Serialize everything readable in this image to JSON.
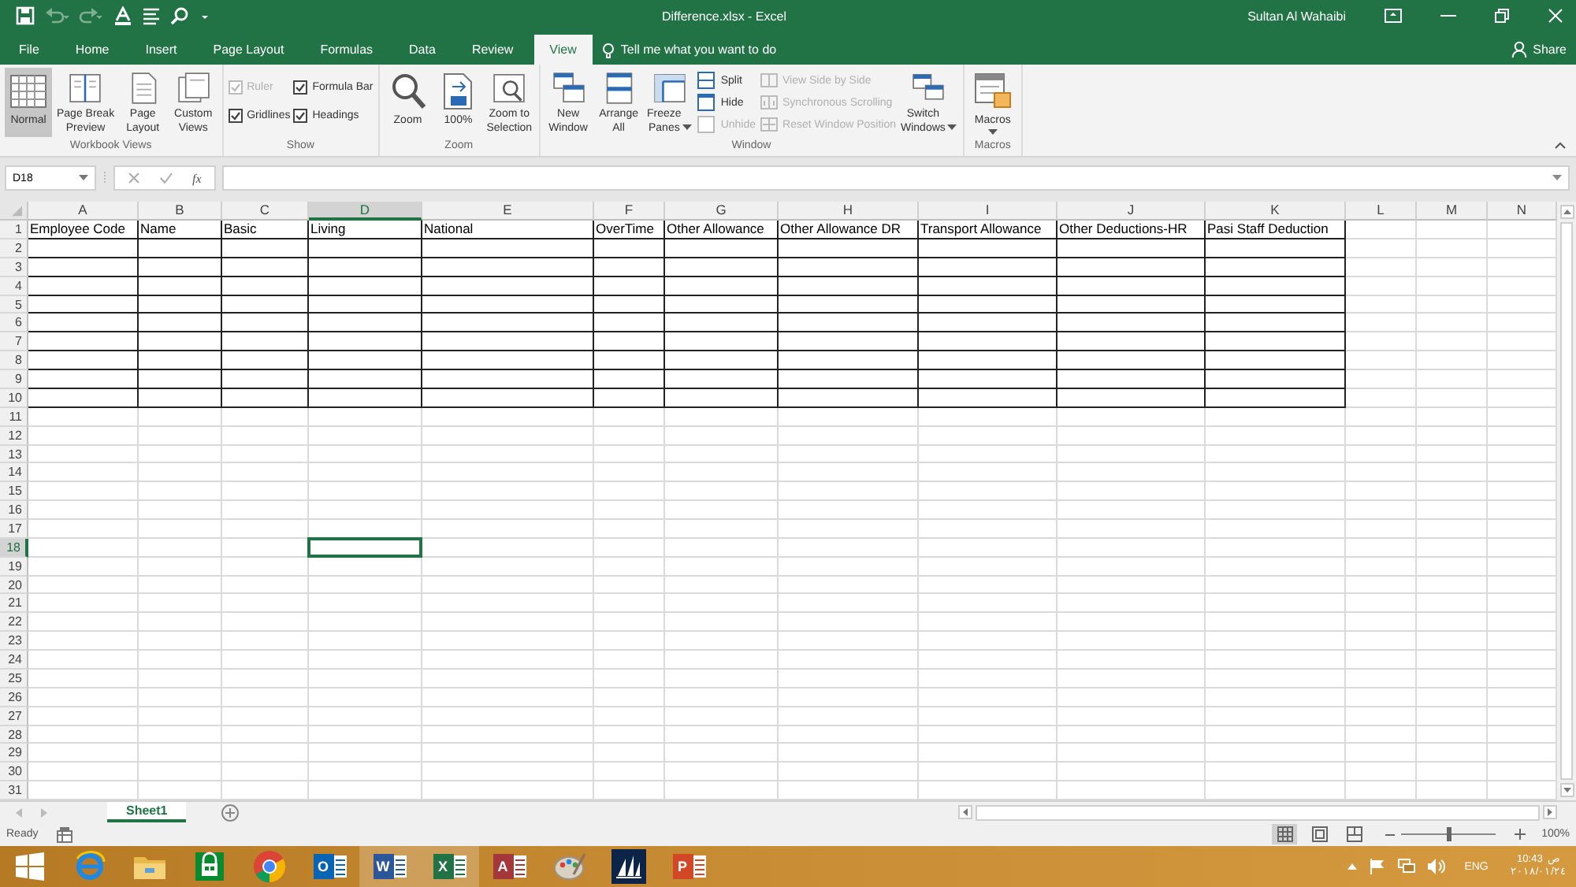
{
  "window": {
    "title": "Difference.xlsx  -  Excel",
    "user": "Sultan Al Wahaibi"
  },
  "tabs": [
    {
      "label": "File",
      "selected": false
    },
    {
      "label": "Home",
      "selected": false
    },
    {
      "label": "Insert",
      "selected": false
    },
    {
      "label": "Page Layout",
      "selected": false
    },
    {
      "label": "Formulas",
      "selected": false
    },
    {
      "label": "Data",
      "selected": false
    },
    {
      "label": "Review",
      "selected": false
    },
    {
      "label": "View",
      "selected": true
    }
  ],
  "tell_me": "Tell me what you want to do",
  "share": "Share",
  "ribbon": [
    {
      "name": "Workbook Views",
      "items": [
        {
          "kind": "large",
          "label": "Normal",
          "selected": true
        },
        {
          "kind": "large",
          "label": "Page Break\nPreview",
          "selected": false
        },
        {
          "kind": "large",
          "label": "Page\nLayout",
          "selected": false
        },
        {
          "kind": "large",
          "label": "Custom\nViews",
          "selected": false
        }
      ]
    },
    {
      "name": "Show",
      "items": [
        {
          "kind": "check",
          "label": "Ruler",
          "checked": true,
          "disabled": true
        },
        {
          "kind": "check",
          "label": "Gridlines",
          "checked": true,
          "disabled": false
        },
        {
          "kind": "check",
          "label": "Formula Bar",
          "checked": true,
          "disabled": false
        },
        {
          "kind": "check",
          "label": "Headings",
          "checked": true,
          "disabled": false
        }
      ]
    },
    {
      "name": "Zoom",
      "items": [
        {
          "kind": "large",
          "label": "Zoom",
          "selected": false
        },
        {
          "kind": "large",
          "label": "100%",
          "selected": false
        },
        {
          "kind": "large",
          "label": "Zoom to\nSelection",
          "selected": false
        }
      ]
    },
    {
      "name": "Window",
      "items": [
        {
          "kind": "large",
          "label": "New\nWindow",
          "selected": false
        },
        {
          "kind": "large",
          "label": "Arrange\nAll",
          "selected": false
        },
        {
          "kind": "large",
          "label": "Freeze\nPanes",
          "dropdown": true,
          "selected": false
        },
        {
          "kind": "small",
          "label": "Split",
          "disabled": false
        },
        {
          "kind": "small",
          "label": "Hide",
          "disabled": false
        },
        {
          "kind": "small",
          "label": "Unhide",
          "disabled": true
        },
        {
          "kind": "small",
          "label": "View Side by Side",
          "disabled": true
        },
        {
          "kind": "small",
          "label": "Synchronous Scrolling",
          "disabled": true
        },
        {
          "kind": "small",
          "label": "Reset Window Position",
          "disabled": true
        },
        {
          "kind": "large",
          "label": "Switch\nWindows",
          "dropdown": true,
          "selected": false
        }
      ]
    },
    {
      "name": "Macros",
      "items": [
        {
          "kind": "large",
          "label": "Macros",
          "dropdown": true,
          "selected": false
        }
      ]
    }
  ],
  "name_box": "D18",
  "function_label": "fx",
  "sheet": {
    "columns": [
      {
        "letter": "A",
        "selected": false,
        "bordered": true
      },
      {
        "letter": "B",
        "selected": false,
        "bordered": true
      },
      {
        "letter": "C",
        "selected": false,
        "bordered": true
      },
      {
        "letter": "D",
        "selected": true,
        "bordered": true
      },
      {
        "letter": "E",
        "selected": false,
        "bordered": true
      },
      {
        "letter": "F",
        "selected": false,
        "bordered": true
      },
      {
        "letter": "G",
        "selected": false,
        "bordered": true
      },
      {
        "letter": "H",
        "selected": false,
        "bordered": true
      },
      {
        "letter": "I",
        "selected": false,
        "bordered": true
      },
      {
        "letter": "J",
        "selected": false,
        "bordered": true
      },
      {
        "letter": "K",
        "selected": false,
        "bordered": true
      },
      {
        "letter": "L",
        "selected": false,
        "bordered": false
      },
      {
        "letter": "M",
        "selected": false,
        "bordered": false
      },
      {
        "letter": "N",
        "selected": false,
        "bordered": false
      }
    ],
    "rows": [
      {
        "number": "1",
        "selected": false,
        "bordered": true,
        "cells": [
          "Employee Code",
          "Name",
          "Basic",
          "Living",
          "National",
          "OverTime",
          "Other Allowance",
          "Other Allowance DR",
          "Transport Allowance",
          "Other Deductions-HR",
          "Pasi Staff Deduction"
        ]
      },
      {
        "number": "2",
        "selected": false,
        "bordered": true
      },
      {
        "number": "3",
        "selected": false,
        "bordered": true
      },
      {
        "number": "4",
        "selected": false,
        "bordered": true
      },
      {
        "number": "5",
        "selected": false,
        "bordered": true
      },
      {
        "number": "6",
        "selected": false,
        "bordered": true
      },
      {
        "number": "7",
        "selected": false,
        "bordered": true
      },
      {
        "number": "8",
        "selected": false,
        "bordered": true
      },
      {
        "number": "9",
        "selected": false,
        "bordered": true
      },
      {
        "number": "10",
        "selected": false,
        "bordered": true
      },
      {
        "number": "11",
        "selected": false,
        "bordered": false
      },
      {
        "number": "12",
        "selected": false,
        "bordered": false
      },
      {
        "number": "13",
        "selected": false,
        "bordered": false
      },
      {
        "number": "14",
        "selected": false,
        "bordered": false
      },
      {
        "number": "15",
        "selected": false,
        "bordered": false
      },
      {
        "number": "16",
        "selected": false,
        "bordered": false
      },
      {
        "number": "17",
        "selected": false,
        "bordered": false
      },
      {
        "number": "18",
        "selected": true,
        "bordered": false
      },
      {
        "number": "19",
        "selected": false,
        "bordered": false
      },
      {
        "number": "20",
        "selected": false,
        "bordered": false
      },
      {
        "number": "21",
        "selected": false,
        "bordered": false
      },
      {
        "number": "22",
        "selected": false,
        "bordered": false
      },
      {
        "number": "23",
        "selected": false,
        "bordered": false
      },
      {
        "number": "24",
        "selected": false,
        "bordered": false
      },
      {
        "number": "25",
        "selected": false,
        "bordered": false
      },
      {
        "number": "26",
        "selected": false,
        "bordered": false
      },
      {
        "number": "27",
        "selected": false,
        "bordered": false
      },
      {
        "number": "28",
        "selected": false,
        "bordered": false
      },
      {
        "number": "29",
        "selected": false,
        "bordered": false
      },
      {
        "number": "30",
        "selected": false,
        "bordered": false
      },
      {
        "number": "31",
        "selected": false,
        "bordered": false
      }
    ]
  },
  "sheet_tabs": [
    {
      "label": "Sheet1",
      "selected": true
    }
  ],
  "status_bar": {
    "text": "Ready",
    "views": [
      {
        "selected": true
      },
      {
        "selected": false
      },
      {
        "selected": false
      }
    ],
    "zoom": {
      "level": 0.5,
      "reading": "100%"
    }
  },
  "taskbar": {
    "apps": [
      {
        "kind": "start",
        "selected": false
      },
      {
        "kind": "browser",
        "selected": false
      },
      {
        "kind": "folder",
        "selected": false
      },
      {
        "kind": "store",
        "selected": false
      },
      {
        "kind": "chrome",
        "selected": false
      },
      {
        "kind": "office",
        "glyph": "O",
        "color": "#0a64b4",
        "selected": false
      },
      {
        "kind": "office",
        "glyph": "W",
        "color": "#2b579a",
        "selected": true
      },
      {
        "kind": "office",
        "glyph": "X",
        "color": "#217346",
        "selected": true
      },
      {
        "kind": "office",
        "glyph": "A",
        "color": "#a4373a",
        "selected": false
      },
      {
        "kind": "paint",
        "selected": false
      },
      {
        "kind": "dynamics",
        "selected": false
      },
      {
        "kind": "office",
        "glyph": "P",
        "color": "#d24726",
        "selected": false
      }
    ],
    "language": "ENG",
    "time": "10:43",
    "period": "ص",
    "date": "٢٠١٨/٠١/٢٤"
  }
}
